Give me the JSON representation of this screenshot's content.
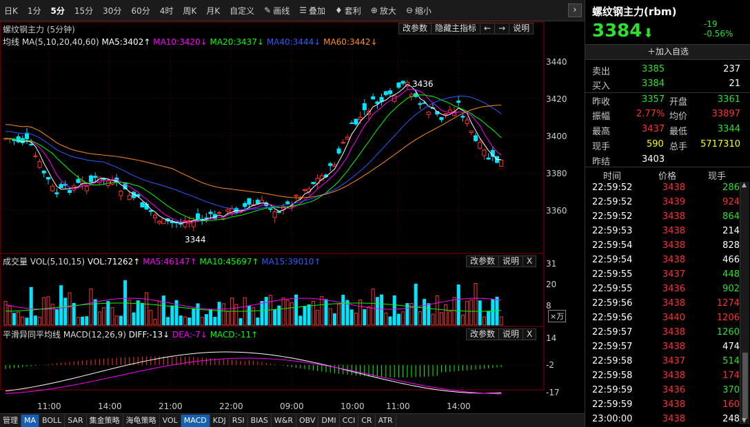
{
  "toolbar": {
    "items": [
      "日K",
      "1分",
      "5分",
      "15分",
      "30分",
      "60分",
      "4时",
      "周K",
      "月K",
      "自定义",
      "画线",
      "叠加",
      "套利",
      "放大",
      "缩小"
    ],
    "active": "5分"
  },
  "main_pane": {
    "title": "螺纹钢主力 (5分钟)",
    "ma_line": "均线 MA(5,10,20,40,60)",
    "ma5": "MA5:3402↑",
    "ma10": "MA10:3420↓",
    "ma20": "MA20:3437↓",
    "ma40": "MA40:3444↓",
    "ma60": "MA60:3442↓",
    "buttons": [
      "改参数",
      "隐藏主指标",
      "←",
      "→",
      "说明"
    ],
    "y_ticks": [
      "3440",
      "3420",
      "3400",
      "3380",
      "3360"
    ],
    "high_label": "3436",
    "low_label": "3344"
  },
  "vol_pane": {
    "title": "成交量 VOL(5,10,15)",
    "vol": "VOL:71262↑",
    "ma5": "MA5:46147↑",
    "ma10": "MA10:45697↑",
    "ma15": "MA15:39010↑",
    "buttons": [
      "改参数",
      "说明",
      "X"
    ],
    "y_ticks": [
      "31",
      "20",
      "8"
    ],
    "unit": "×万"
  },
  "macd_pane": {
    "title": "平滑异同平均线 MACD(12,26,9)",
    "diff": "DIFF:-13↓",
    "dea": "DEA:-7↓",
    "macd": "MACD:-11↑",
    "buttons": [
      "改参数",
      "说明",
      "X"
    ],
    "y_ticks": [
      "14",
      "-2",
      "-17"
    ]
  },
  "x_labels": [
    "11:00",
    "14:00",
    "21:00",
    "22:00",
    "09:00",
    "10:00",
    "11:00",
    "14:00"
  ],
  "bottom_tabs": [
    "管理",
    "MA",
    "BOLL",
    "SAR",
    "集金策略",
    "海龟策略",
    "VOL",
    "MACD",
    "KDJ",
    "RSI",
    "BIAS",
    "W&R",
    "OBV",
    "DMI",
    "CCI",
    "CR",
    "ATR"
  ],
  "bottom_tabs_selected": [
    "MA",
    "MACD"
  ],
  "quote": {
    "title": "螺纹钢主力(rbm)",
    "price": "3384",
    "change": "-19",
    "change_pct": "-0.56%",
    "watch": "加入自选",
    "sell_label": "卖出",
    "sell_price": "3385",
    "sell_vol": "237",
    "buy_label": "买入",
    "buy_price": "3384",
    "buy_vol": "21",
    "prev_close_label": "昨收",
    "prev_close": "3357",
    "open_label": "开盘",
    "open": "3361",
    "amp_label": "振幅",
    "amp": "2.77%",
    "avg_label": "均价",
    "avg": "33897",
    "high_label": "最高",
    "high": "3437",
    "low_label": "最低",
    "low": "3344",
    "cur_vol_label": "现手",
    "cur_vol": "590",
    "total_label": "总手",
    "total": "5717310",
    "settle_label": "昨结",
    "settle": "3403"
  },
  "ticks_header": [
    "时间",
    "价格",
    "现手"
  ],
  "ticks": [
    {
      "t": "22:59:52",
      "p": "3438",
      "v": "286",
      "c": "green"
    },
    {
      "t": "22:59:52",
      "p": "3439",
      "v": "924",
      "c": "red"
    },
    {
      "t": "22:59:52",
      "p": "3438",
      "v": "864",
      "c": "green"
    },
    {
      "t": "22:59:53",
      "p": "3438",
      "v": "214",
      "c": "white"
    },
    {
      "t": "22:59:54",
      "p": "3438",
      "v": "828",
      "c": "white"
    },
    {
      "t": "22:59:54",
      "p": "3438",
      "v": "466",
      "c": "white"
    },
    {
      "t": "22:59:55",
      "p": "3437",
      "v": "448",
      "c": "green"
    },
    {
      "t": "22:59:55",
      "p": "3436",
      "v": "902",
      "c": "green"
    },
    {
      "t": "22:59:56",
      "p": "3438",
      "v": "1274",
      "c": "red"
    },
    {
      "t": "22:59:56",
      "p": "3440",
      "v": "1206",
      "c": "red"
    },
    {
      "t": "22:59:57",
      "p": "3438",
      "v": "1260",
      "c": "green"
    },
    {
      "t": "22:59:57",
      "p": "3438",
      "v": "474",
      "c": "white"
    },
    {
      "t": "22:59:58",
      "p": "3437",
      "v": "514",
      "c": "green"
    },
    {
      "t": "22:59:58",
      "p": "3438",
      "v": "174",
      "c": "red"
    },
    {
      "t": "22:59:59",
      "p": "3436",
      "v": "370",
      "c": "green"
    },
    {
      "t": "22:59:59",
      "p": "3438",
      "v": "160",
      "c": "red"
    },
    {
      "t": "23:00:00",
      "p": "3438",
      "v": "248",
      "c": "white"
    }
  ],
  "colors": {
    "up": "#ff3232",
    "down": "#00e5ff",
    "ma5": "#ffffff",
    "ma10": "#ff00ff",
    "ma20": "#00ff00",
    "ma40": "#2a5bff",
    "ma60": "#ff8c1a"
  }
}
